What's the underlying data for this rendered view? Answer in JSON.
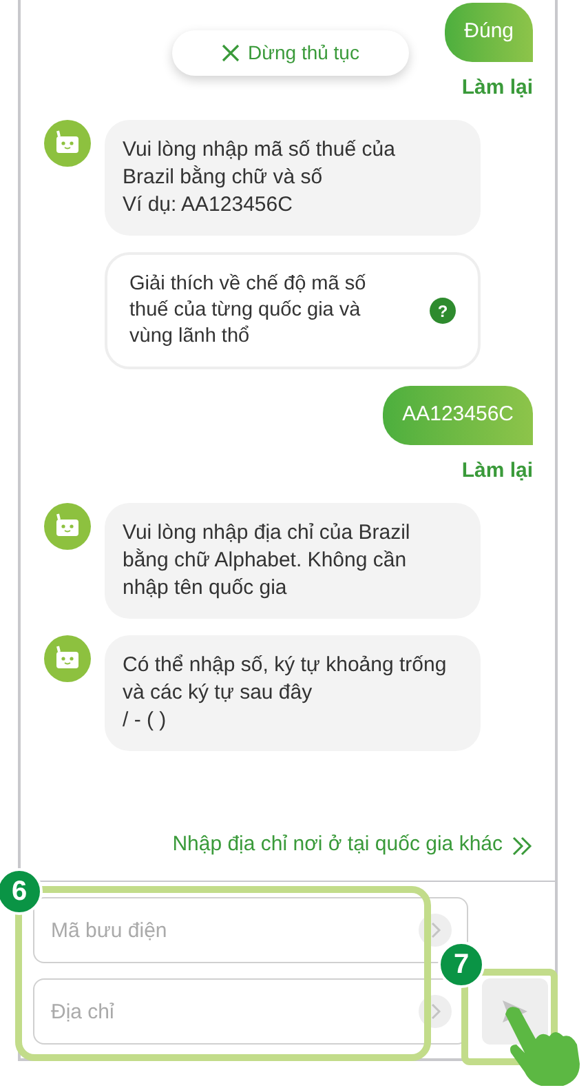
{
  "stop_button": {
    "label": "Dừng thủ tục"
  },
  "messages": [
    {
      "kind": "user",
      "text": "Đúng"
    },
    {
      "kind": "retry",
      "text": "Làm lại"
    },
    {
      "kind": "bot",
      "text": "Vui lòng nhập mã số thuế của Brazil bằng chữ và số\nVí dụ: AA123456C"
    },
    {
      "kind": "info",
      "text": "Giải thích về chế độ mã số thuế của từng quốc gia và vùng lãnh thổ",
      "icon_text": "?"
    },
    {
      "kind": "user",
      "text": "AA123456C"
    },
    {
      "kind": "retry",
      "text": "Làm lại"
    },
    {
      "kind": "bot",
      "text": "Vui lòng nhập địa chỉ của Brazil bằng chữ Alphabet. Không cần nhập tên quốc gia"
    },
    {
      "kind": "bot",
      "text": "Có thể nhập số, ký tự khoảng trống và các ký tự sau đây\n/ - ( )"
    }
  ],
  "other_country_link": "Nhập địa chỉ nơi ở tại quốc gia khác",
  "fields": [
    {
      "placeholder": "Mã bưu điện"
    },
    {
      "placeholder": "Địa chỉ"
    }
  ],
  "send_button": {
    "disabled": true
  },
  "annotations": [
    {
      "label": "6"
    },
    {
      "label": "7"
    }
  ]
}
